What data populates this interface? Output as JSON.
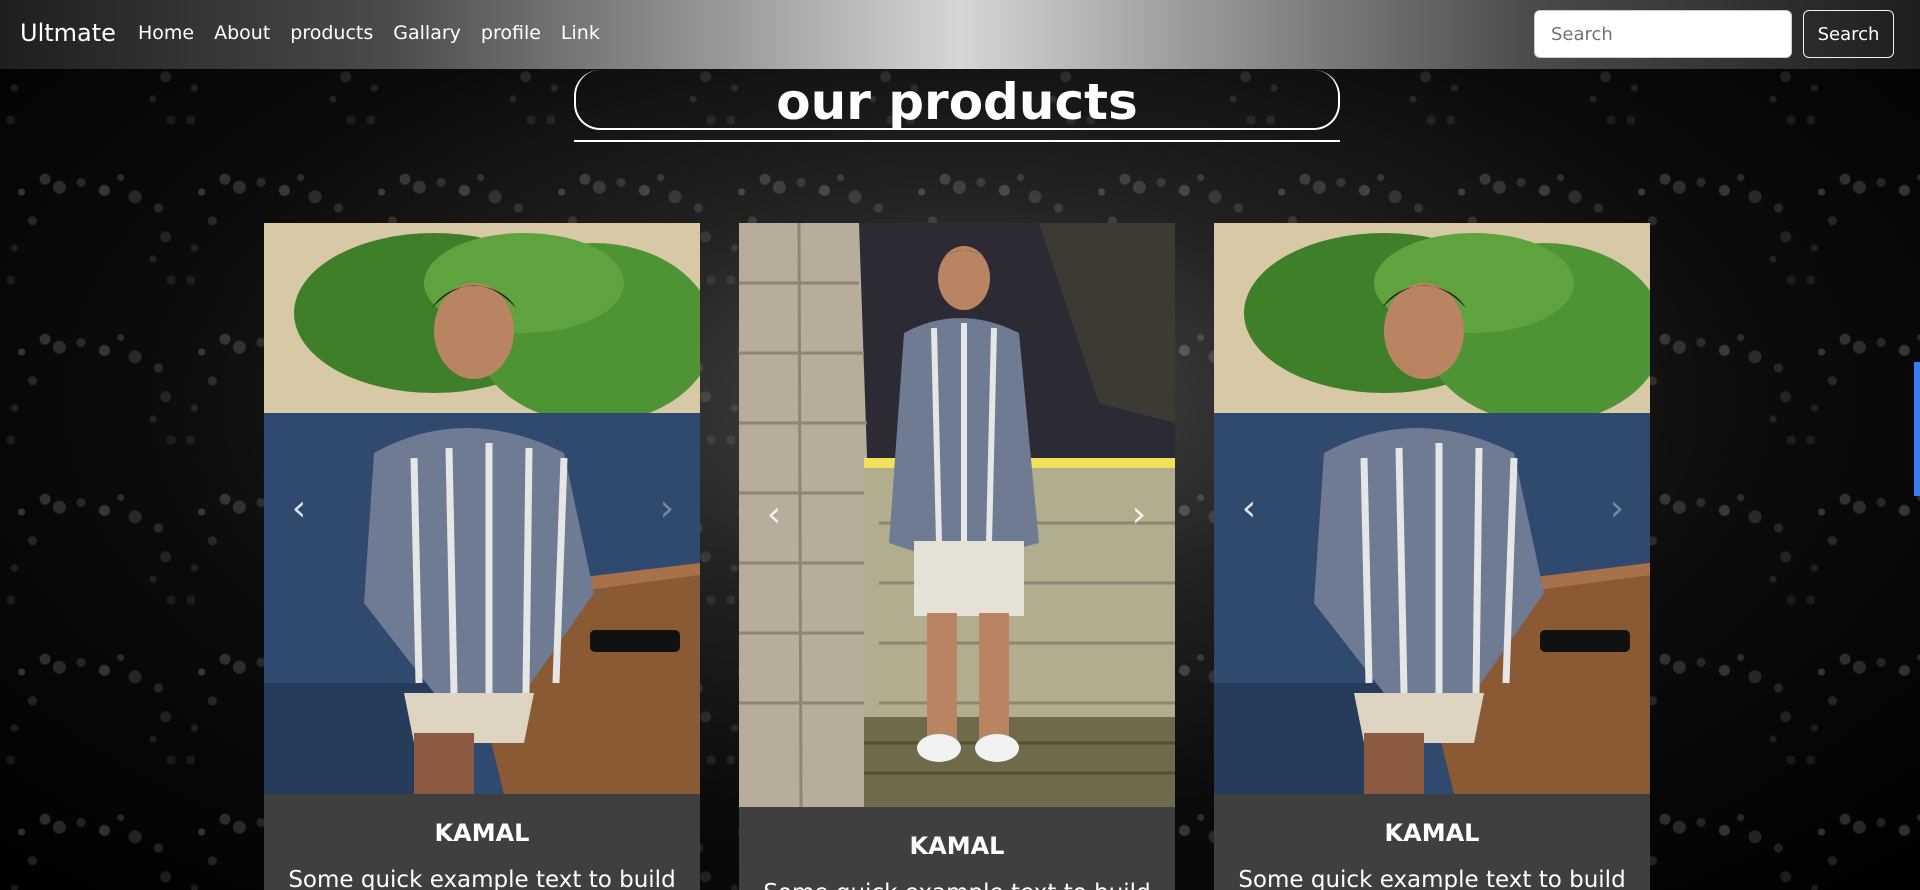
{
  "navbar": {
    "brand": "Ultmate",
    "links": [
      "Home",
      "About",
      "products",
      "Gallary",
      "profile",
      "Link"
    ],
    "search_placeholder": "Search",
    "search_button": "Search"
  },
  "section": {
    "heading": "our products"
  },
  "cards": [
    {
      "title": "KAMAL",
      "text": "Some quick example text to build"
    },
    {
      "title": "KAMAL",
      "text": "Some quick example text to build"
    },
    {
      "title": "KAMAL",
      "text": "Some quick example text to build"
    }
  ],
  "icons": {
    "prev": "chevron-left-icon",
    "next": "chevron-right-icon"
  },
  "colors": {
    "card_bg": "#3f3f3f",
    "scroll_accent": "#3a7bf0"
  }
}
